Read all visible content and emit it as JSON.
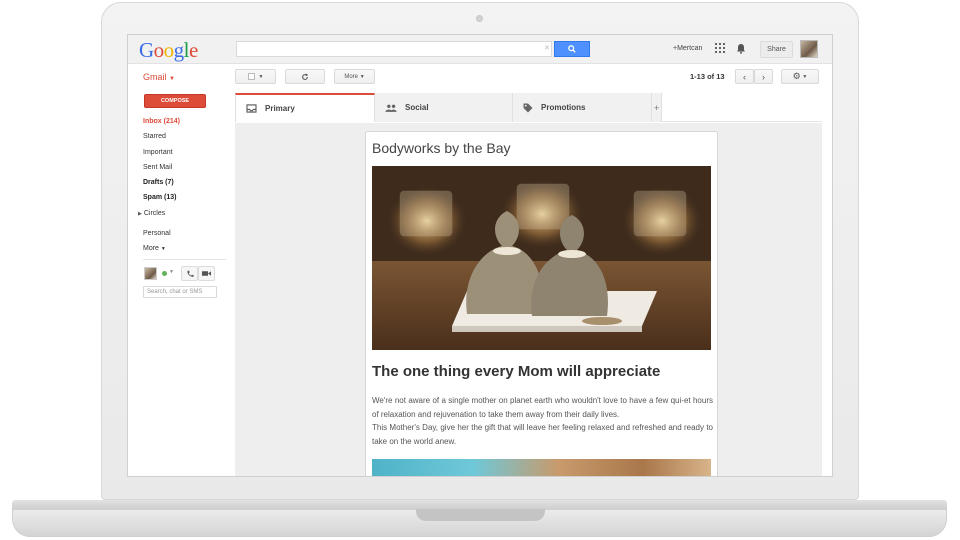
{
  "topbar": {
    "logo": "Google",
    "search_placeholder": "",
    "user": "+Mertcan",
    "share_label": "Share"
  },
  "toolbar": {
    "app_label": "Gmail",
    "more_label": "More",
    "pager": "1-13 of 13"
  },
  "sidebar": {
    "compose_label": "COMPOSE",
    "items": [
      {
        "label": "Inbox (214)"
      },
      {
        "label": "Starred"
      },
      {
        "label": "Important"
      },
      {
        "label": "Sent Mail"
      },
      {
        "label": "Drafts (7)"
      },
      {
        "label": "Spam (13)"
      },
      {
        "label": "Circles"
      },
      {
        "label": "Personal"
      },
      {
        "label": "More"
      }
    ],
    "chat_search_placeholder": "Search, chat or SMS"
  },
  "tabs": [
    {
      "label": "Primary",
      "icon": "inbox-icon"
    },
    {
      "label": "Social",
      "icon": "people-icon"
    },
    {
      "label": "Promotions",
      "icon": "tag-icon"
    },
    {
      "label": "+"
    }
  ],
  "email": {
    "sender": "Bodyworks by the Bay",
    "headline": "The one thing every Mom will appreciate",
    "paragraph1": "We're not aware of a single mother on planet earth who wouldn't love to have a few qui-et hours of relaxation and rejuvenation to take them away from their daily lives.",
    "paragraph2": "This Mother's Day, give her the gift that will leave her feeling relaxed and refreshed and ready to take on the world anew."
  },
  "colors": {
    "accent": "#dd4b39",
    "search_button": "#4d90fe"
  }
}
